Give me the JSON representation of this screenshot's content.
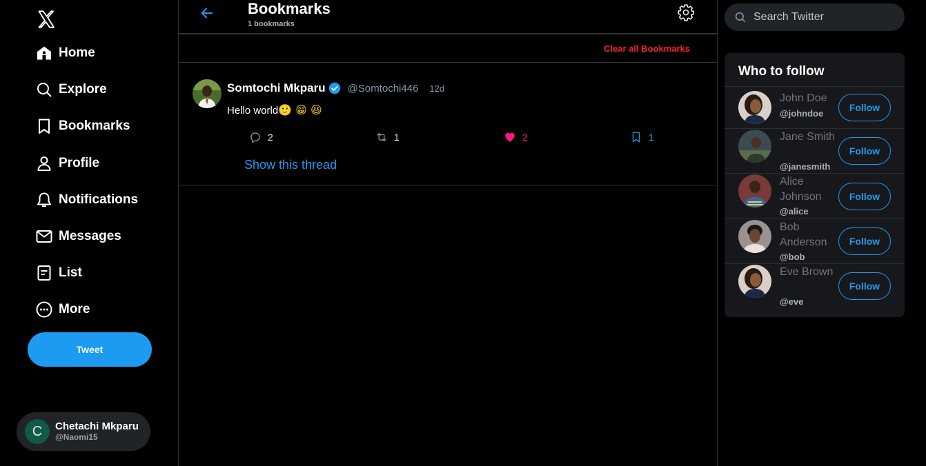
{
  "nav": {
    "logo": "x-logo-icon",
    "items": [
      {
        "label": "Home",
        "icon": "home-icon"
      },
      {
        "label": "Explore",
        "icon": "search-icon"
      },
      {
        "label": "Bookmarks",
        "icon": "bookmark-icon"
      },
      {
        "label": "Profile",
        "icon": "person-icon"
      },
      {
        "label": "Notifications",
        "icon": "bell-icon"
      },
      {
        "label": "Messages",
        "icon": "envelope-icon"
      },
      {
        "label": "List",
        "icon": "list-icon"
      },
      {
        "label": "More",
        "icon": "more-circle-icon"
      }
    ],
    "tweet_button": "Tweet"
  },
  "account": {
    "initial": "C",
    "name": "Chetachi Mkparu",
    "handle": "@Naomi15"
  },
  "header": {
    "title": "Bookmarks",
    "subtitle": "1 bookmarks",
    "clear_label": "Clear all Bookmarks"
  },
  "tweet": {
    "name": "Somtochi Mkparu",
    "handle": "@Somtochi446",
    "time": "12d",
    "text": "Hello world",
    "emoji": "🙂 😁 😆",
    "replies": "2",
    "retweets": "1",
    "likes": "2",
    "bookmarks": "1",
    "show_thread": "Show this thread"
  },
  "search": {
    "placeholder": "Search Twitter"
  },
  "who_to_follow": {
    "title": "Who to follow",
    "follow_label": "Follow",
    "users": [
      {
        "name": "John Doe",
        "handle": "@johndoe"
      },
      {
        "name": "Jane Smith",
        "handle": "@janesmith"
      },
      {
        "name": "Alice Johnson",
        "handle": "@alice"
      },
      {
        "name": "Bob Anderson",
        "handle": "@bob"
      },
      {
        "name": "Eve Brown",
        "handle": "@eve"
      }
    ]
  },
  "colors": {
    "accent": "#1d9bf0",
    "danger": "#f4212e",
    "like": "#f91880"
  }
}
